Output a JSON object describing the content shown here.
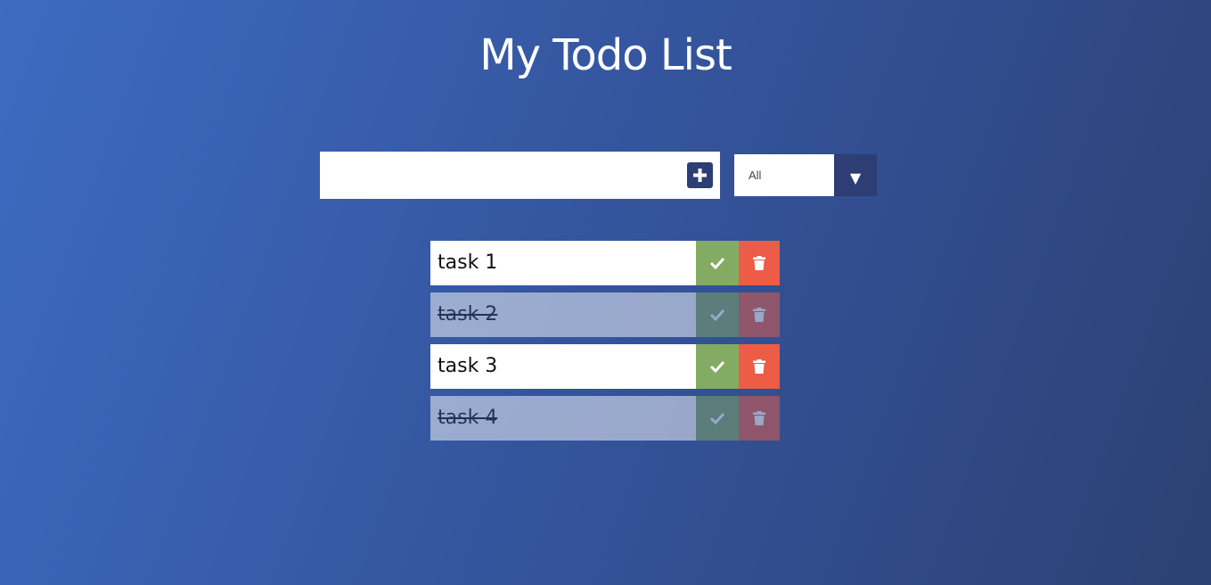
{
  "header": {
    "title": "My Todo List"
  },
  "input": {
    "value": "",
    "placeholder": ""
  },
  "filter": {
    "selected": "All"
  },
  "todos": [
    {
      "text": "task 1",
      "completed": false
    },
    {
      "text": "task 2",
      "completed": true
    },
    {
      "text": "task 3",
      "completed": false
    },
    {
      "text": "task 4",
      "completed": true
    }
  ],
  "icons": {
    "add": "plus-square-icon",
    "dropdown": "triangle-down-icon",
    "complete": "check-icon",
    "delete": "trash-icon"
  },
  "colors": {
    "accent": "#2c3e74",
    "complete": "#83ab63",
    "delete": "#ec5c46"
  }
}
